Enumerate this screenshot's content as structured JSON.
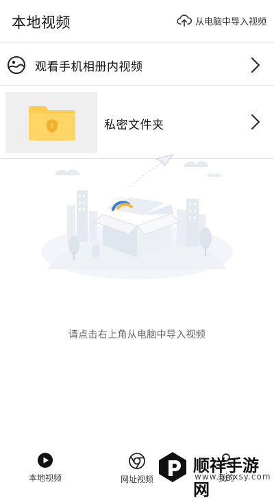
{
  "header": {
    "title": "本地视频",
    "import_label": "从电脑中导入视频",
    "import_icon": "cloud-upload-icon"
  },
  "album_row": {
    "label": "观看手机相册内视频",
    "icon": "gallery-icon"
  },
  "private_row": {
    "label": "私密文件夹",
    "icon": "locked-folder-icon",
    "folder_color": "#FDCB52"
  },
  "empty_state": {
    "hint": "请点击右上角从电脑中导入视频"
  },
  "tabbar": {
    "tabs": [
      {
        "label": "本地视频",
        "icon": "play-circle-icon",
        "active": true
      },
      {
        "label": "网址视频",
        "icon": "browser-icon",
        "active": false
      },
      {
        "label": "我的",
        "icon": "profile-icon",
        "active": false
      }
    ]
  },
  "watermark": {
    "text": "顺祥手游网",
    "url": "www.bjsxsy.com"
  }
}
